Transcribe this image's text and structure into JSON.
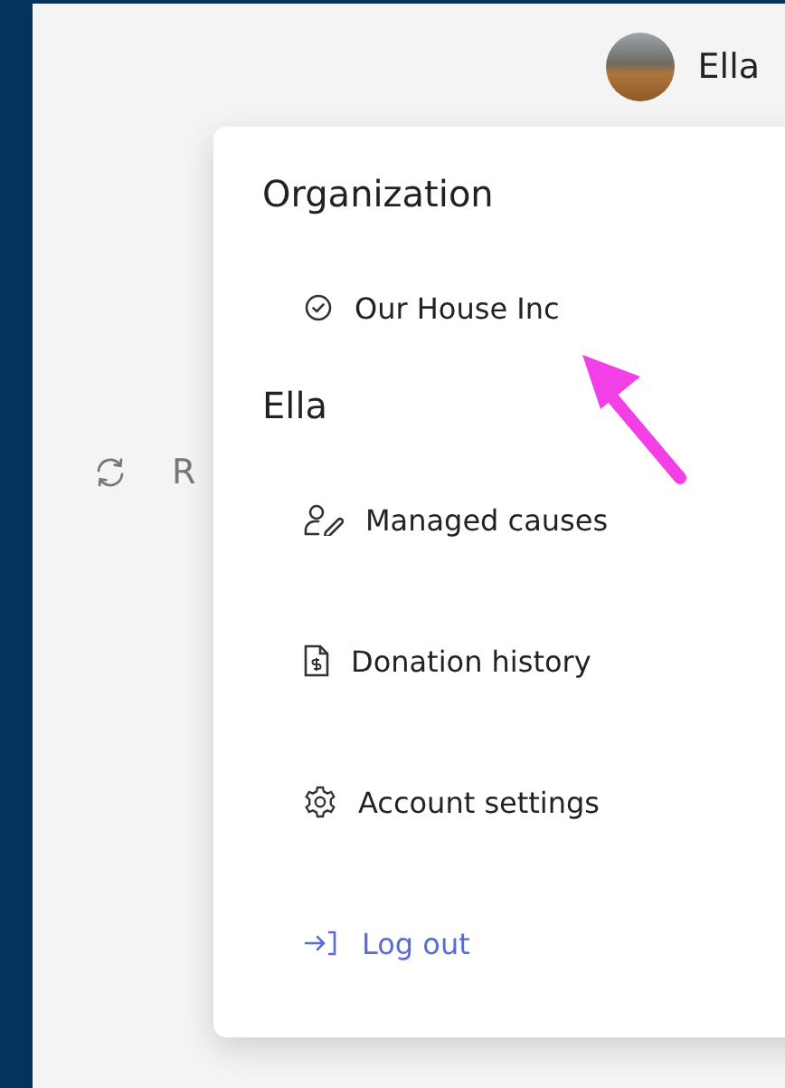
{
  "header": {
    "user_name": "Ella"
  },
  "background_item": {
    "label": "R"
  },
  "menu": {
    "sections": [
      {
        "title": "Organization",
        "items": [
          {
            "label": "Our House Inc",
            "kind": "org",
            "selected": true
          }
        ]
      },
      {
        "title": "Ella",
        "items": [
          {
            "label": "Managed causes",
            "kind": "causes"
          },
          {
            "label": "Donation history",
            "kind": "donations"
          },
          {
            "label": "Account settings",
            "kind": "settings"
          }
        ]
      }
    ],
    "logout": {
      "label": "Log out"
    }
  }
}
